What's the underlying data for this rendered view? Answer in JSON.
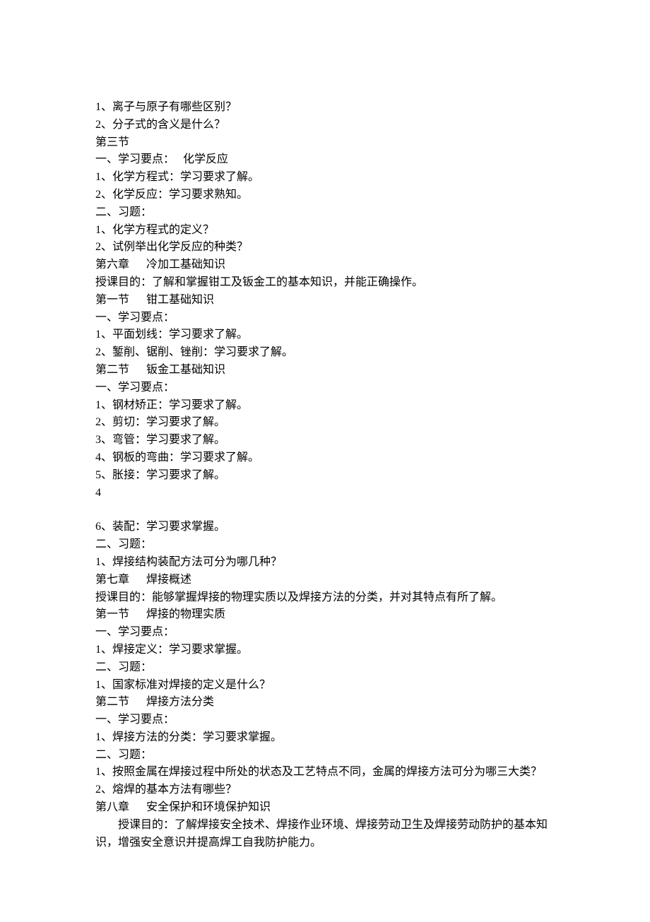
{
  "lines": [
    {
      "text": "1、离子与原子有哪些区别？",
      "cls": ""
    },
    {
      "text": "2、分子式的含义是什么？",
      "cls": ""
    },
    {
      "text": "第三节",
      "cls": ""
    },
    {
      "text": "一、学习要点：   化学反应",
      "cls": ""
    },
    {
      "text": "1、化学方程式：学习要求了解。",
      "cls": ""
    },
    {
      "text": "2、化学反应：学习要求熟知。",
      "cls": ""
    },
    {
      "text": "二、习题：",
      "cls": ""
    },
    {
      "text": "1、化学方程式的定义？",
      "cls": ""
    },
    {
      "text": "2、试例举出化学反应的种类？",
      "cls": ""
    },
    {
      "text": "第六章      冷加工基础知识",
      "cls": ""
    },
    {
      "text": "授课目的：了解和掌握钳工及钣金工的基本知识，并能正确操作。",
      "cls": ""
    },
    {
      "text": "第一节      钳工基础知识",
      "cls": ""
    },
    {
      "text": "一、学习要点：",
      "cls": ""
    },
    {
      "text": "1、平面划线：学习要求了解。",
      "cls": ""
    },
    {
      "text": "2、錾削、锯削、锉削：学习要求了解。",
      "cls": ""
    },
    {
      "text": "第二节      钣金工基础知识",
      "cls": ""
    },
    {
      "text": "一、学习要点：",
      "cls": ""
    },
    {
      "text": "1、钢材矫正：学习要求了解。",
      "cls": ""
    },
    {
      "text": "2、剪切：学习要求了解。",
      "cls": ""
    },
    {
      "text": "3、弯管：学习要求了解。",
      "cls": ""
    },
    {
      "text": "4、钢板的弯曲：学习要求了解。",
      "cls": ""
    },
    {
      "text": "5、胀接：学习要求了解。",
      "cls": ""
    },
    {
      "text": "4",
      "cls": ""
    },
    {
      "text": "",
      "cls": "gap"
    },
    {
      "text": "6、装配：学习要求掌握。",
      "cls": ""
    },
    {
      "text": "二、习题：",
      "cls": ""
    },
    {
      "text": "1、焊接结构装配方法可分为哪几种？",
      "cls": ""
    },
    {
      "text": "第七章      焊接概述",
      "cls": ""
    },
    {
      "text": "授课目的：能够掌握焊接的物理实质以及焊接方法的分类，并对其特点有所了解。",
      "cls": ""
    },
    {
      "text": "第一节      焊接的物理实质",
      "cls": ""
    },
    {
      "text": "一、学习要点：",
      "cls": ""
    },
    {
      "text": "1、焊接定义：学习要求掌握。",
      "cls": ""
    },
    {
      "text": "二、习题：",
      "cls": ""
    },
    {
      "text": "1、国家标准对焊接的定义是什么？",
      "cls": ""
    },
    {
      "text": "第二节      焊接方法分类",
      "cls": ""
    },
    {
      "text": "一、学习要点：",
      "cls": ""
    },
    {
      "text": "1、焊接方法的分类：学习要求掌握。",
      "cls": ""
    },
    {
      "text": "二、习题：",
      "cls": ""
    },
    {
      "text": "1、按照金属在焊接过程中所处的状态及工艺特点不同，金属的焊接方法可分为哪三大类？",
      "cls": ""
    },
    {
      "text": "2、熔焊的基本方法有哪些？",
      "cls": ""
    },
    {
      "text": "第八章      安全保护和环境保护知识",
      "cls": ""
    },
    {
      "text": "授课目的：了解焊接安全技术、焊接作业环境、焊接劳动卫生及焊接劳动防护的基本知识，增强安全意识并提高焊工自我防护能力。",
      "cls": "indent"
    }
  ]
}
